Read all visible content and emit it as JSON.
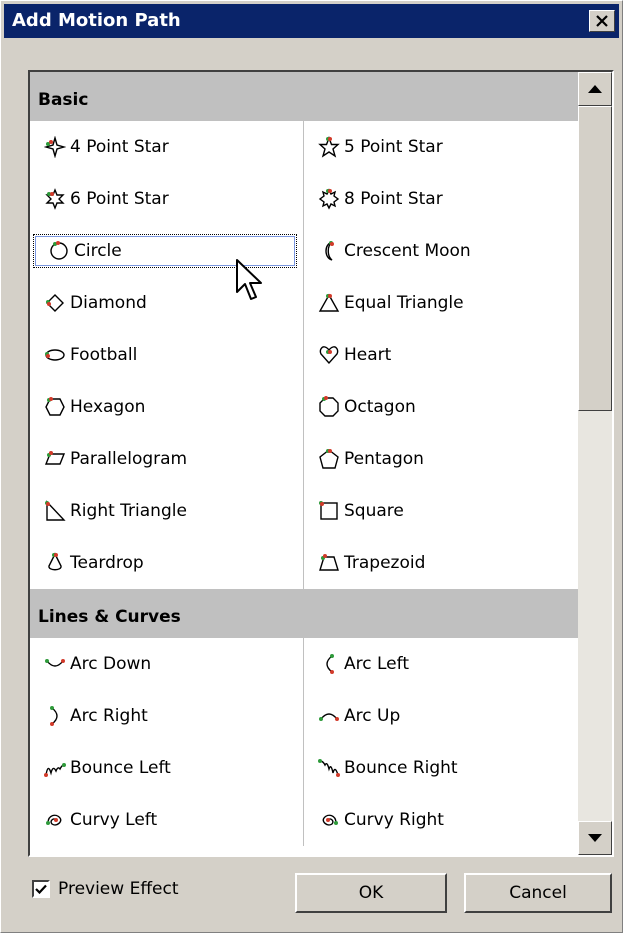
{
  "dialog": {
    "title": "Add Motion Path",
    "close_icon": "close-icon"
  },
  "sections": [
    {
      "header": "Basic",
      "rows": [
        [
          {
            "label": "4 Point Star",
            "icon": "4-point-star-icon"
          },
          {
            "label": "5 Point Star",
            "icon": "5-point-star-icon"
          }
        ],
        [
          {
            "label": "6 Point Star",
            "icon": "6-point-star-icon"
          },
          {
            "label": "8 Point Star",
            "icon": "8-point-star-icon"
          }
        ],
        [
          {
            "label": "Circle",
            "icon": "circle-icon",
            "selected": true
          },
          {
            "label": "Crescent Moon",
            "icon": "crescent-moon-icon"
          }
        ],
        [
          {
            "label": "Diamond",
            "icon": "diamond-icon"
          },
          {
            "label": "Equal Triangle",
            "icon": "equal-triangle-icon"
          }
        ],
        [
          {
            "label": "Football",
            "icon": "football-icon"
          },
          {
            "label": "Heart",
            "icon": "heart-icon"
          }
        ],
        [
          {
            "label": "Hexagon",
            "icon": "hexagon-icon"
          },
          {
            "label": "Octagon",
            "icon": "octagon-icon"
          }
        ],
        [
          {
            "label": "Parallelogram",
            "icon": "parallelogram-icon"
          },
          {
            "label": "Pentagon",
            "icon": "pentagon-icon"
          }
        ],
        [
          {
            "label": "Right Triangle",
            "icon": "right-triangle-icon"
          },
          {
            "label": "Square",
            "icon": "square-icon"
          }
        ],
        [
          {
            "label": "Teardrop",
            "icon": "teardrop-icon"
          },
          {
            "label": "Trapezoid",
            "icon": "trapezoid-icon"
          }
        ]
      ]
    },
    {
      "header": "Lines & Curves",
      "rows": [
        [
          {
            "label": "Arc Down",
            "icon": "arc-down-icon"
          },
          {
            "label": "Arc Left",
            "icon": "arc-left-icon"
          }
        ],
        [
          {
            "label": "Arc Right",
            "icon": "arc-right-icon"
          },
          {
            "label": "Arc Up",
            "icon": "arc-up-icon"
          }
        ],
        [
          {
            "label": "Bounce Left",
            "icon": "bounce-left-icon"
          },
          {
            "label": "Bounce Right",
            "icon": "bounce-right-icon"
          }
        ],
        [
          {
            "label": "Curvy Left",
            "icon": "curvy-left-icon"
          },
          {
            "label": "Curvy Right",
            "icon": "curvy-right-icon"
          }
        ]
      ]
    }
  ],
  "footer": {
    "preview_label": "Preview Effect",
    "preview_checked": true,
    "ok_label": "OK",
    "cancel_label": "Cancel"
  },
  "colors": {
    "titlebar": "#0a246a",
    "face": "#d4d0c8",
    "section_header": "#c0c0c0",
    "path_start": "#2e9a3a",
    "path_end": "#d23a2a"
  }
}
